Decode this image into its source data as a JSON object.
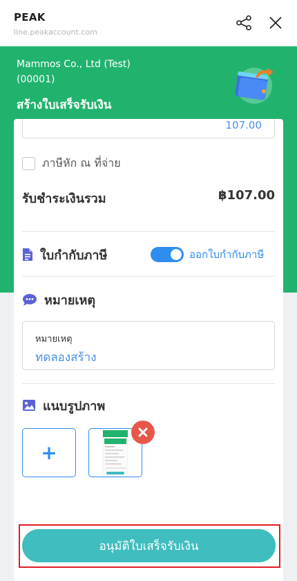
{
  "browser": {
    "title": "PEAK",
    "url": "line.peakaccount.com"
  },
  "header": {
    "company_name": "Mammos Co., Ltd (Test)",
    "company_code": "(00001)",
    "page_title": "สร้างใบเสร็จรับเงิน",
    "icon": "wallet-icon"
  },
  "form": {
    "amount_value": "107.00",
    "withholding_tax": {
      "label": "ภาษีหัก ณ ที่จ่าย",
      "checked": false
    },
    "total": {
      "label": "รับชำระเงินรวม",
      "value": "฿107.00"
    },
    "tax_invoice": {
      "title": "ใบกำกับภาษี",
      "icon": "document-icon",
      "toggle_label": "ออกใบกำกับภาษี",
      "toggle_on": true
    },
    "remarks": {
      "title": "หมายเหตุ",
      "icon": "comment-icon",
      "field_label": "หมายเหตุ",
      "field_value": "ทดลองสร้าง"
    },
    "attachments": {
      "title": "แนบรูปภาพ",
      "icon": "image-icon",
      "add_label": "+"
    }
  },
  "actions": {
    "approve_label": "อนุมัติใบเสร็จรับเงิน"
  },
  "colors": {
    "brand_green": "#21b36e",
    "accent_blue": "#2f8df0",
    "approve_button": "#3fbdbf",
    "highlight_red": "#e01b24",
    "remove_red": "#e8584a"
  }
}
